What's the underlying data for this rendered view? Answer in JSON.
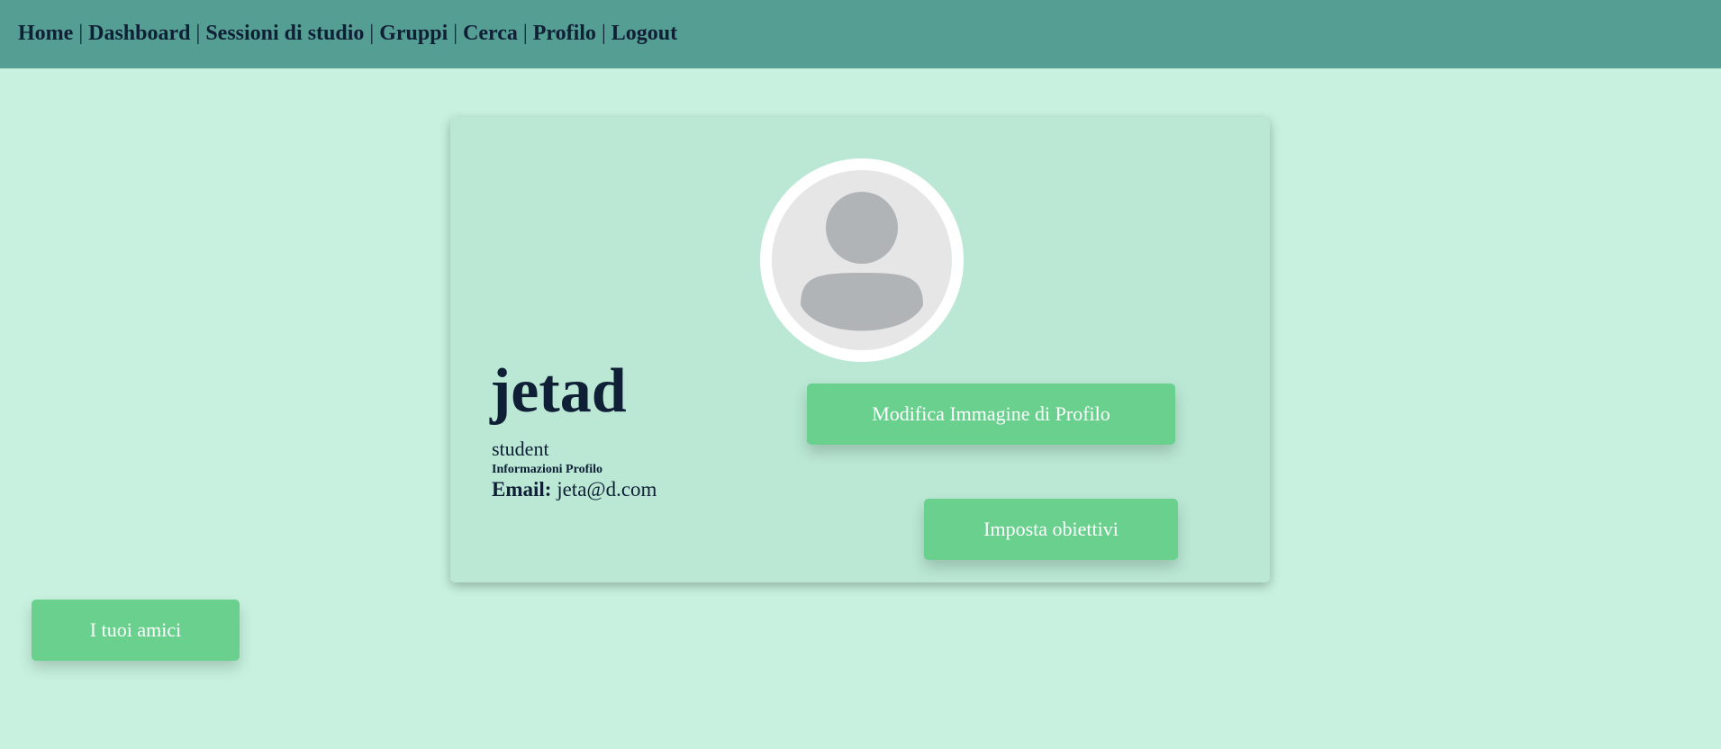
{
  "nav": {
    "items": [
      {
        "label": "Home"
      },
      {
        "label": "Dashboard"
      },
      {
        "label": "Sessioni di studio"
      },
      {
        "label": "Gruppi"
      },
      {
        "label": "Cerca"
      },
      {
        "label": "Profilo"
      },
      {
        "label": "Logout"
      }
    ],
    "separator": "|"
  },
  "profile": {
    "username": "jetad",
    "role": "student",
    "info_heading": "Informazioni Profilo",
    "email_label": "Email:",
    "email_value": "jeta@d.com",
    "avatar_icon": "user-placeholder-icon"
  },
  "buttons": {
    "edit_image": "Modifica Immagine di Profilo",
    "set_goals": "Imposta obiettivi",
    "friends": "I tuoi amici"
  },
  "colors": {
    "navbar": "#549e93",
    "background": "#c8f2df",
    "card": "#bae8d4",
    "button": "#69d08e",
    "text": "#0f1f36"
  }
}
